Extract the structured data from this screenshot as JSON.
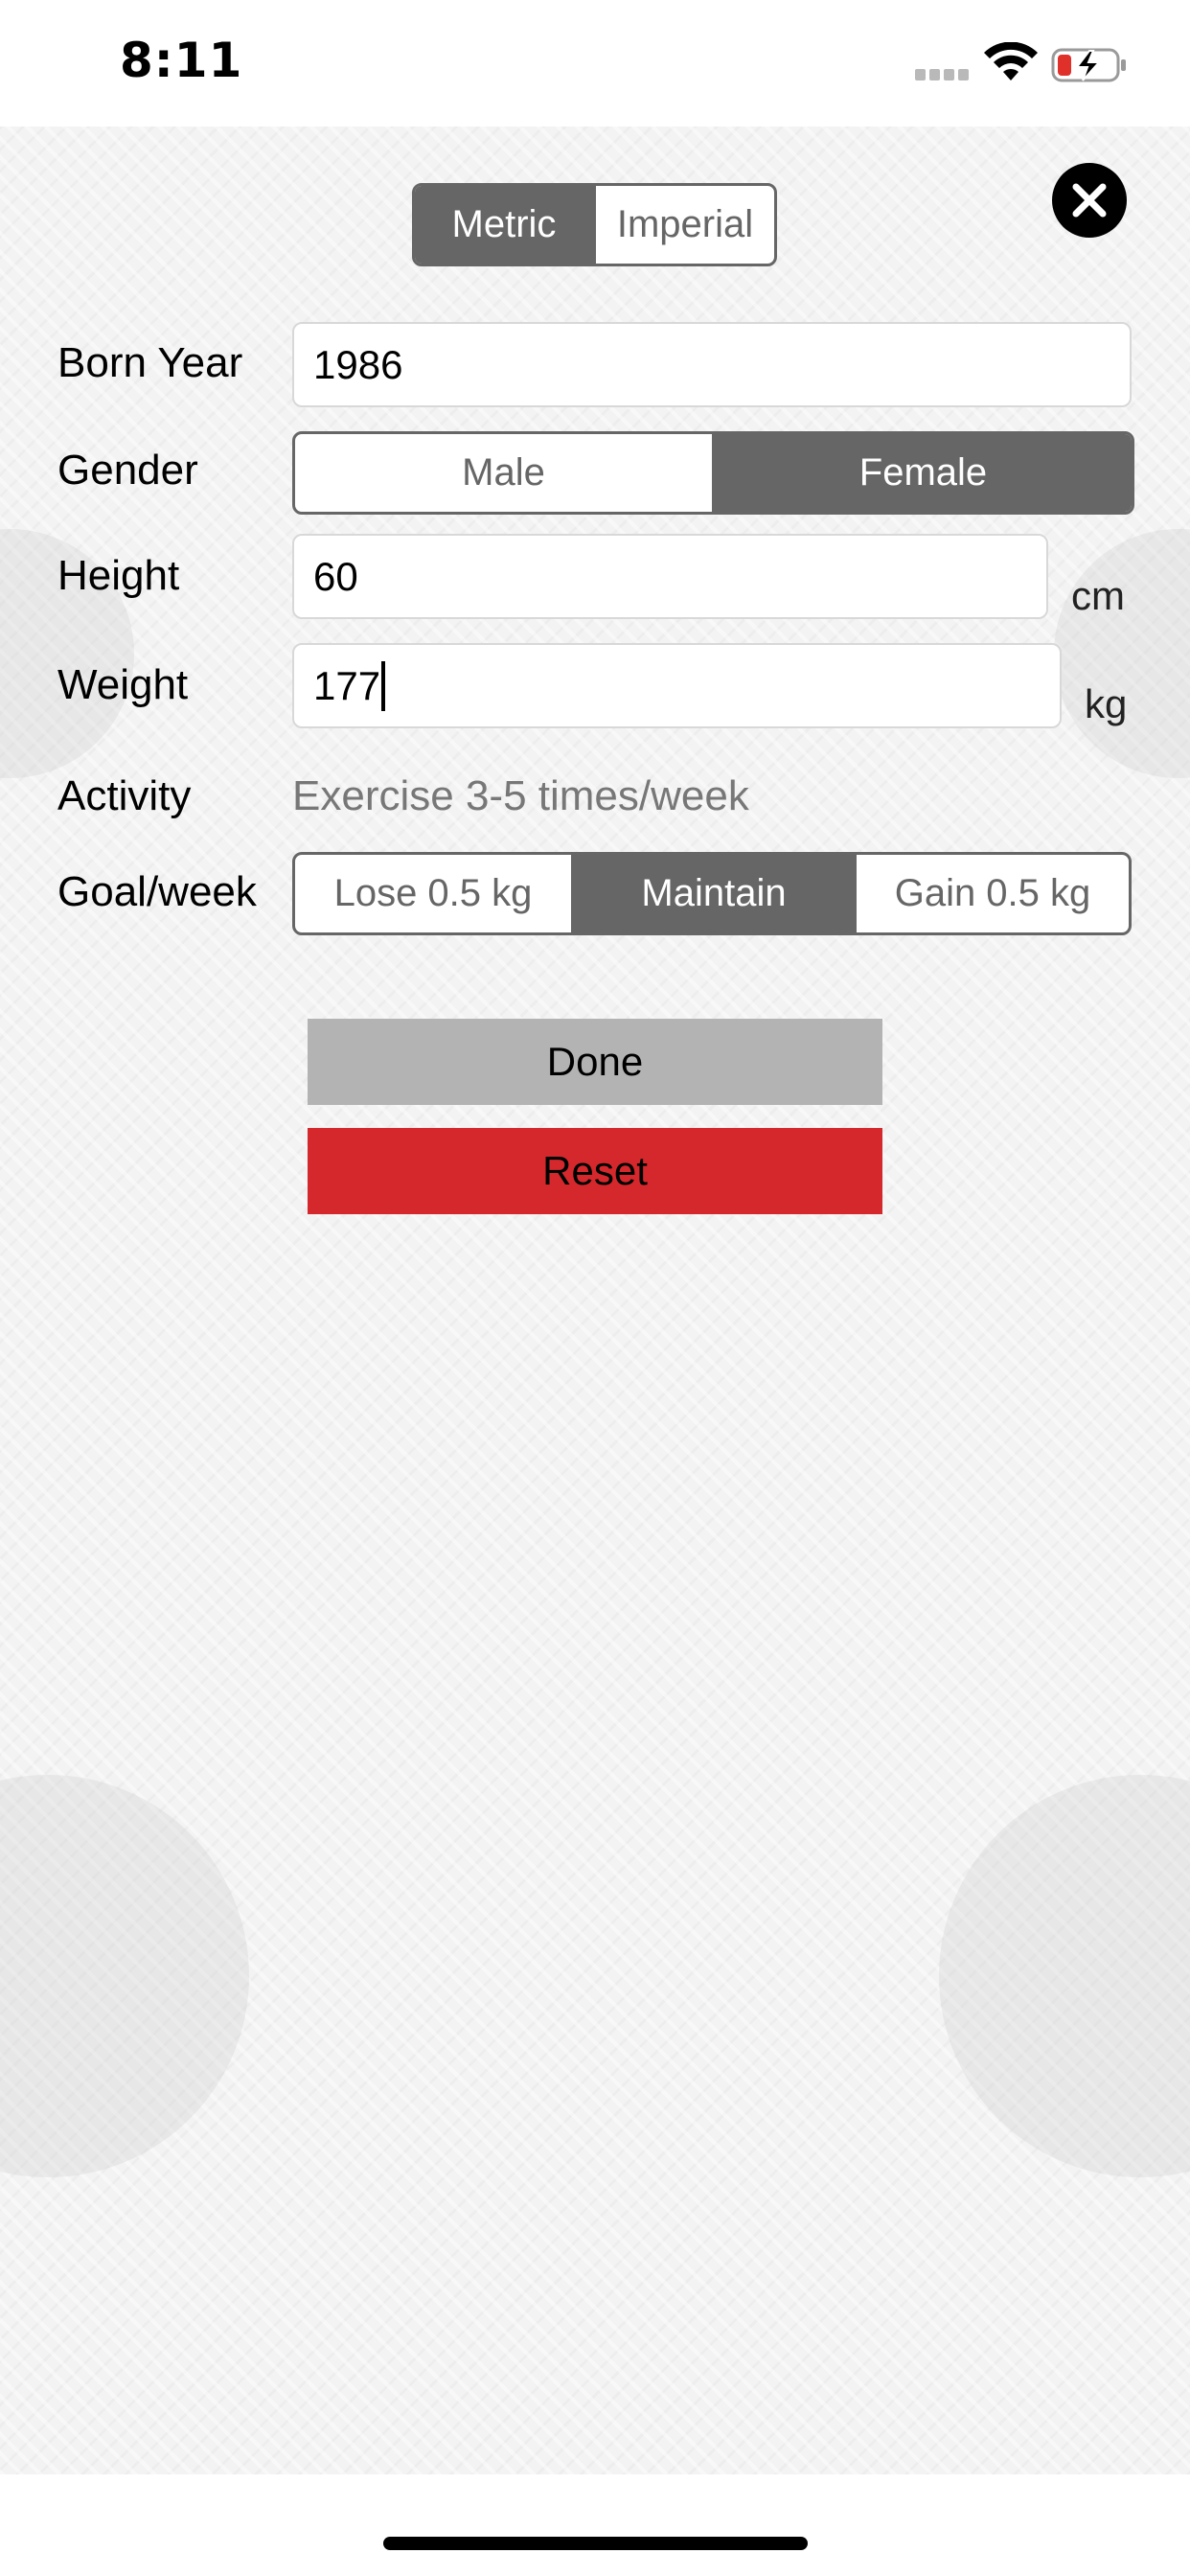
{
  "status_bar": {
    "time": "8:11",
    "signal_icon": "cellular-signal-icon",
    "wifi_icon": "wifi-icon",
    "battery_icon": "battery-charging-icon",
    "battery_color": "#e0302a"
  },
  "header": {
    "close_icon": "close-icon",
    "units": {
      "options": [
        "Metric",
        "Imperial"
      ],
      "selected": "Metric"
    }
  },
  "form": {
    "born_year": {
      "label": "Born Year",
      "value": "1986"
    },
    "gender": {
      "label": "Gender",
      "options": [
        "Male",
        "Female"
      ],
      "selected": "Female"
    },
    "height": {
      "label": "Height",
      "value": "60",
      "unit": "cm"
    },
    "weight": {
      "label": "Weight",
      "value": "177",
      "unit": "kg"
    },
    "activity": {
      "label": "Activity",
      "value": "Exercise 3-5 times/week"
    },
    "goal": {
      "label": "Goal/week",
      "options": [
        "Lose 0.5 kg",
        "Maintain",
        "Gain 0.5 kg"
      ],
      "selected": "Maintain"
    }
  },
  "actions": {
    "done_label": "Done",
    "reset_label": "Reset",
    "reset_color": "#d4282c"
  },
  "colors": {
    "selected_segment": "#666666",
    "background": "#f3f3f3"
  }
}
